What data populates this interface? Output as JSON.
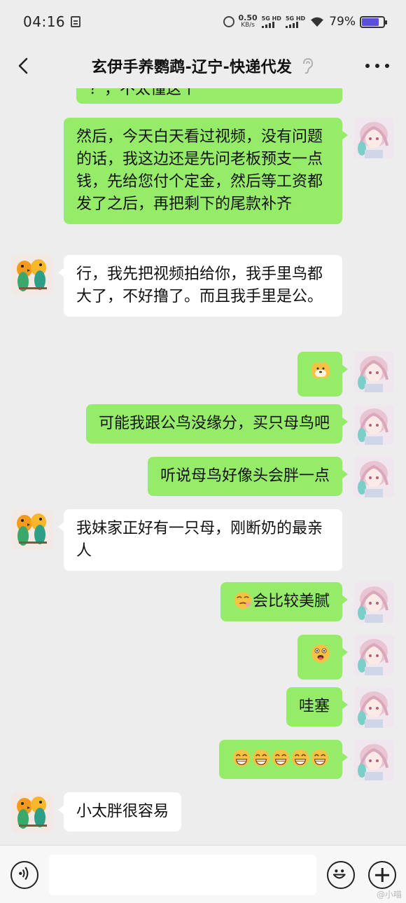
{
  "status_bar": {
    "time": "04:16",
    "net_speed_value": "0.50",
    "net_speed_unit": "KB/s",
    "sim1_label": "5G HD",
    "sim2_label": "5G HD",
    "battery_percent": "79%",
    "battery_level": 0.79,
    "battery_color": "#5b4fd8"
  },
  "header": {
    "title": "玄伊手养鹦鹉-辽宁-快递代发",
    "back_icon": "chevron-left-icon",
    "mute_icon": "ear-icon",
    "more_icon": "more-dots-icon"
  },
  "messages": [
    {
      "side": "out",
      "kind": "text",
      "text": "？，不太懂这个",
      "partial": true
    },
    {
      "side": "out",
      "kind": "text",
      "text": "然后，今天白天看过视频，没有问题的话，我这边还是先问老板预支一点钱，先给您付个定金，然后等工资都发了之后，再把剩下的尾款补齐"
    },
    {
      "side": "in",
      "kind": "text",
      "text": "行，我先把视频拍给你，我手里鸟都大了，不好撸了。而且我手里是公。"
    },
    {
      "side": "out",
      "kind": "sticker",
      "text": "",
      "icon": "doge-emoji-icon"
    },
    {
      "side": "out",
      "kind": "text",
      "text": "可能我跟公鸟没缘分，买只母鸟吧"
    },
    {
      "side": "out",
      "kind": "text",
      "text": "听说母鸟好像头会胖一点"
    },
    {
      "side": "in",
      "kind": "text",
      "text": "我妹家正好有一只母，刚断奶的最亲人"
    },
    {
      "side": "out",
      "kind": "text",
      "text": "会比较美腻",
      "icon": "smirk-emoji-icon"
    },
    {
      "side": "out",
      "kind": "sticker",
      "text": "",
      "icon": "tongue-emoji-icon"
    },
    {
      "side": "out",
      "kind": "text",
      "text": "哇塞"
    },
    {
      "side": "out",
      "kind": "sticker",
      "text": "",
      "icon": "grin-emoji-icon",
      "repeat": 5
    },
    {
      "side": "in",
      "kind": "text",
      "text": "小太胖很容易"
    }
  ],
  "input_bar": {
    "voice_icon": "voice-icon",
    "placeholder": "",
    "emoji_icon": "emoji-face-icon",
    "plus_icon": "plus-icon"
  },
  "colors": {
    "outgoing_bubble": "#95ec69",
    "incoming_bubble": "#ffffff",
    "background": "#ededed"
  },
  "watermark": "@小喵"
}
